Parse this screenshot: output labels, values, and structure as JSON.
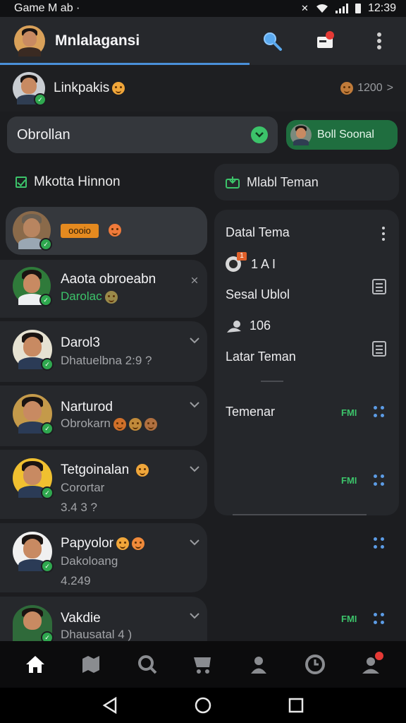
{
  "status_bar": {
    "left_text": "Game M ab  ·",
    "time": "12:39"
  },
  "header": {
    "title": "Mnlalagansi",
    "search_icon": "search-icon",
    "notification_icon": "mailbox-icon",
    "menu_icon": "kebab-icon"
  },
  "linked": {
    "name": "Linkpakis",
    "count": "1200",
    "chevron": ">"
  },
  "search": {
    "label": "Obrollan"
  },
  "friend_pill": {
    "label": "Boll Soonal"
  },
  "left_column": {
    "heading": "Mkotta Hinnon",
    "chats": [
      {
        "name": "",
        "tag": "oooio",
        "sub": "",
        "time": ""
      },
      {
        "name": "Aaota obroeabn",
        "sub": "Darolac",
        "time": ""
      },
      {
        "name": "Darol3",
        "sub": "Dhatuelbna 2:9 ?",
        "time": ""
      },
      {
        "name": "Narturod",
        "sub": "Obrokarn",
        "time": ""
      },
      {
        "name": "Tetgoinalan",
        "sub": "Corortar",
        "time": "3.4 3 ?"
      },
      {
        "name": "Papyolor",
        "sub": "Dakoloang",
        "time": "4.249"
      },
      {
        "name": "Vakdie",
        "sub": "Dhausatal 4 )",
        "time": ""
      }
    ]
  },
  "right_column": {
    "heading": "Mlabl Teman",
    "panel": {
      "title": "Datal Tema",
      "row1_value": "1 A I",
      "row1_badge": "1",
      "row2_label": "Sesal Ublol",
      "row3_value": "106",
      "row4_label": "Latar Teman",
      "row5_label": "Temenar",
      "tag_1": "FMI",
      "tag_2": "FMI",
      "tag_3": "FMI"
    }
  },
  "colors": {
    "accent": "#3cc36a",
    "blue": "#4a90d9",
    "background": "#1c1d20",
    "notification": "#e53935"
  }
}
